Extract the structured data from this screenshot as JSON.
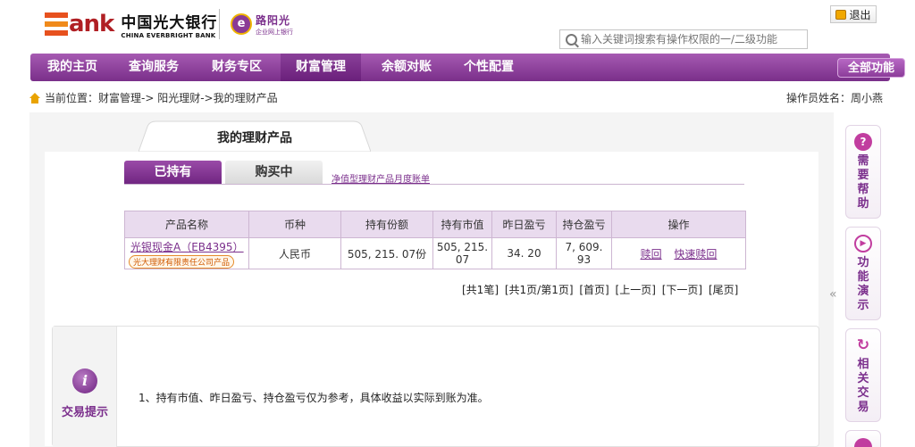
{
  "header": {
    "bank_name_cn": "中国光大银行",
    "bank_name_en": "CHINA EVERBRIGHT BANK",
    "bank_logo_text": "ank",
    "sub_brand": "路阳光",
    "sub_brand_small": "企业网上银行",
    "logout_label": "退出",
    "search_placeholder": "输入关键词搜索有操作权限的一/二级功能"
  },
  "nav": {
    "items": [
      {
        "label": "我的主页"
      },
      {
        "label": "查询服务"
      },
      {
        "label": "财务专区"
      },
      {
        "label": "财富管理",
        "active": true
      },
      {
        "label": "余额对账"
      },
      {
        "label": "个性配置"
      }
    ],
    "all_functions": "全部功能"
  },
  "breadcrumb": {
    "prefix": "当前位置：",
    "path": "财富管理-> 阳光理财->我的理财产品"
  },
  "operator": "操作员姓名：周小燕",
  "main": {
    "section_title": "我的理财产品",
    "tabs": [
      {
        "label": "已持有",
        "active": true
      },
      {
        "label": "购买中",
        "active": false
      }
    ],
    "monthly_statement_link": "净值型理财产品月度账单",
    "table": {
      "headers": [
        "产品名称",
        "币种",
        "持有份额",
        "持有市值",
        "昨日盈亏",
        "持仓盈亏",
        "操作"
      ],
      "rows": [
        {
          "product_name": "光银现金A（EB4395）",
          "product_badge": "光大理财有限责任公司产品",
          "currency": "人民币",
          "shares": "505, 215. 07份",
          "market_value": "505, 215. 07",
          "yesterday_pnl": "34. 20",
          "position_pnl": "7, 609. 93",
          "actions": [
            "赎回",
            "快速赎回"
          ]
        }
      ]
    },
    "pager": [
      "[共1笔]",
      "[共1页/第1页]",
      "[首页]",
      "[上一页]",
      "[下一页]",
      "[尾页]"
    ],
    "tip": {
      "label": "交易提示",
      "text": "1、持有市值、昨日盈亏、持仓盈亏仅为参考，具体收益以实际到账为准。"
    }
  },
  "side_panel": [
    {
      "label": "需要帮助",
      "icon": "help-icon"
    },
    {
      "label": "功能演示",
      "icon": "play-icon"
    },
    {
      "label": "相关交易",
      "icon": "refresh-icon"
    }
  ],
  "collapse_glyph_left": "»",
  "collapse_glyph_right": "«",
  "colors": {
    "brand_purple": "#7b2f8c",
    "nav_purple": "#8e449c",
    "logo_orange": "#e7511e",
    "logo_red": "#b01f24"
  }
}
